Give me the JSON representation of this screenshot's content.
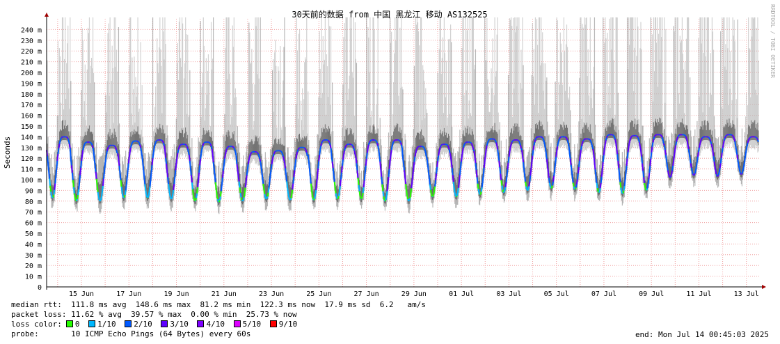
{
  "chart_data": {
    "type": "area",
    "title": "30天前的数据 from 中国 黑龙江 移动 AS132525",
    "ylabel": "Seconds",
    "watermark": "RRDTOOL / TOBI OETIKER",
    "ylim": [
      0,
      250
    ],
    "yticks": [
      "0",
      "10 m",
      "20 m",
      "30 m",
      "40 m",
      "50 m",
      "60 m",
      "70 m",
      "80 m",
      "90 m",
      "100 m",
      "110 m",
      "120 m",
      "130 m",
      "140 m",
      "150 m",
      "160 m",
      "170 m",
      "180 m",
      "190 m",
      "200 m",
      "210 m",
      "220 m",
      "230 m",
      "240 m"
    ],
    "xticks": [
      "15 Jun",
      "17 Jun",
      "19 Jun",
      "21 Jun",
      "23 Jun",
      "25 Jun",
      "27 Jun",
      "29 Jun",
      "01 Jul",
      "03 Jul",
      "05 Jul",
      "07 Jul",
      "09 Jul",
      "11 Jul",
      "13 Jul"
    ],
    "series": [
      {
        "name": "median rtt",
        "color": "#00b8ff",
        "daily_min_ms": [
          83,
          80,
          80,
          83,
          83,
          82,
          80,
          79,
          80,
          82,
          81,
          81,
          82,
          82,
          80,
          80,
          84,
          84,
          86,
          88,
          90,
          92,
          91,
          88,
          87,
          90,
          102,
          104,
          103,
          105
        ],
        "daily_max_ms": [
          140,
          135,
          132,
          136,
          137,
          133,
          135,
          131,
          126,
          127,
          130,
          137,
          133,
          137,
          137,
          131,
          133,
          135,
          138,
          137,
          140,
          140,
          138,
          142,
          141,
          142,
          142,
          140,
          142,
          140
        ]
      }
    ],
    "grid": true,
    "background_band": "grey spread of ping rtt (smoke), packet-loss stripes"
  },
  "legend": {
    "median_line": "median rtt:  111.8 ms avg  148.6 ms max  81.2 ms min  122.3 ms now  17.9 ms sd  6.2   am/s",
    "loss_line": "packet loss: 11.62 % avg  39.57 % max  0.00 % min  25.73 % now",
    "loss_color_label": "loss color:",
    "loss_colors": [
      {
        "label": "0",
        "color": "#26ff00"
      },
      {
        "label": "1/10",
        "color": "#00b8ff"
      },
      {
        "label": "2/10",
        "color": "#0059ff"
      },
      {
        "label": "3/10",
        "color": "#5e00ff"
      },
      {
        "label": "4/10",
        "color": "#7e00ff"
      },
      {
        "label": "5/10",
        "color": "#dd00ff"
      },
      {
        "label": "9/10",
        "color": "#ff0000"
      }
    ],
    "probe": "probe:       10 ICMP Echo Pings (64 Bytes) every 60s",
    "end": "end: Mon Jul 14 00:45:03 2025"
  }
}
